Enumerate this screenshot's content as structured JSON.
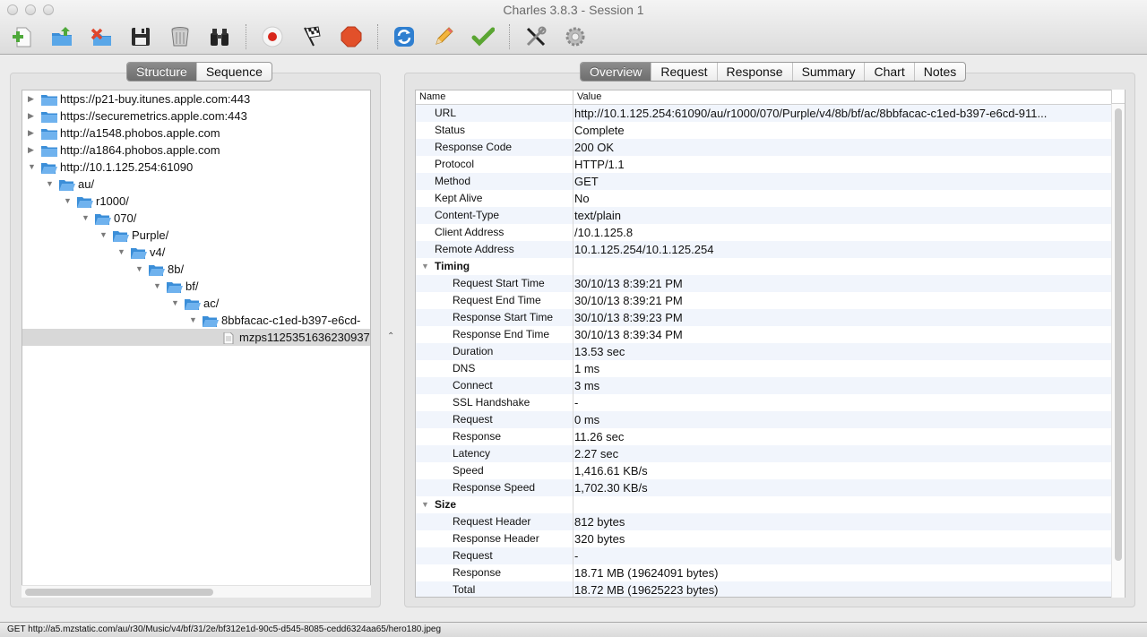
{
  "window": {
    "title": "Charles 3.8.3 - Session 1"
  },
  "toolbar": {
    "groups": [
      [
        {
          "name": "new-session",
          "icon": "new-session-icon"
        },
        {
          "name": "open-session",
          "icon": "open-folder-icon"
        },
        {
          "name": "close-session",
          "icon": "close-folder-icon"
        },
        {
          "name": "save-session",
          "icon": "save-icon"
        },
        {
          "name": "clear-session",
          "icon": "trash-icon"
        },
        {
          "name": "find",
          "icon": "binoculars-icon"
        }
      ],
      [
        {
          "name": "start-recording",
          "icon": "record-icon"
        },
        {
          "name": "start-throttling",
          "icon": "checkered-flag-icon"
        },
        {
          "name": "enable-breakpoints",
          "icon": "stop-sign-icon"
        }
      ],
      [
        {
          "name": "repeat",
          "icon": "refresh-icon"
        },
        {
          "name": "edit",
          "icon": "pencil-icon"
        },
        {
          "name": "validate",
          "icon": "checkmark-icon"
        }
      ],
      [
        {
          "name": "tools",
          "icon": "tools-icon"
        },
        {
          "name": "settings",
          "icon": "gear-icon"
        }
      ]
    ]
  },
  "left": {
    "tabs": [
      {
        "label": "Structure",
        "active": true
      },
      {
        "label": "Sequence",
        "active": false
      }
    ],
    "tree": [
      {
        "label": "https://p21-buy.itunes.apple.com:443",
        "depth": 0,
        "expanded": false,
        "type": "folder"
      },
      {
        "label": "https://securemetrics.apple.com:443",
        "depth": 0,
        "expanded": false,
        "type": "folder"
      },
      {
        "label": "http://a1548.phobos.apple.com",
        "depth": 0,
        "expanded": false,
        "type": "folder"
      },
      {
        "label": "http://a1864.phobos.apple.com",
        "depth": 0,
        "expanded": false,
        "type": "folder"
      },
      {
        "label": "http://10.1.125.254:61090",
        "depth": 0,
        "expanded": true,
        "type": "folder"
      },
      {
        "label": "au/",
        "depth": 1,
        "expanded": true,
        "type": "folder"
      },
      {
        "label": "r1000/",
        "depth": 2,
        "expanded": true,
        "type": "folder"
      },
      {
        "label": "070/",
        "depth": 3,
        "expanded": true,
        "type": "folder"
      },
      {
        "label": "Purple/",
        "depth": 4,
        "expanded": true,
        "type": "folder"
      },
      {
        "label": "v4/",
        "depth": 5,
        "expanded": true,
        "type": "folder"
      },
      {
        "label": "8b/",
        "depth": 6,
        "expanded": true,
        "type": "folder"
      },
      {
        "label": "bf/",
        "depth": 7,
        "expanded": true,
        "type": "folder"
      },
      {
        "label": "ac/",
        "depth": 8,
        "expanded": true,
        "type": "folder"
      },
      {
        "label": "8bbfacac-c1ed-b397-e6cd-",
        "depth": 9,
        "expanded": true,
        "type": "folder"
      },
      {
        "label": "mzps1125351636230937",
        "depth": 10,
        "expanded": false,
        "type": "file",
        "selected": true
      }
    ]
  },
  "right": {
    "tabs": [
      {
        "label": "Overview",
        "active": true
      },
      {
        "label": "Request",
        "active": false
      },
      {
        "label": "Response",
        "active": false
      },
      {
        "label": "Summary",
        "active": false
      },
      {
        "label": "Chart",
        "active": false
      },
      {
        "label": "Notes",
        "active": false
      }
    ],
    "columns": {
      "name": "Name",
      "value": "Value"
    },
    "rows": [
      {
        "name": "URL",
        "value": "http://10.1.125.254:61090/au/r1000/070/Purple/v4/8b/bf/ac/8bbfacac-c1ed-b397-e6cd-911...",
        "kind": "top"
      },
      {
        "name": "Status",
        "value": "Complete",
        "kind": "top"
      },
      {
        "name": "Response Code",
        "value": "200 OK",
        "kind": "top"
      },
      {
        "name": "Protocol",
        "value": "HTTP/1.1",
        "kind": "top"
      },
      {
        "name": "Method",
        "value": "GET",
        "kind": "top"
      },
      {
        "name": "Kept Alive",
        "value": "No",
        "kind": "top"
      },
      {
        "name": "Content-Type",
        "value": "text/plain",
        "kind": "top"
      },
      {
        "name": "Client Address",
        "value": "/10.1.125.8",
        "kind": "top"
      },
      {
        "name": "Remote Address",
        "value": "10.1.125.254/10.1.125.254",
        "kind": "top"
      },
      {
        "name": "Timing",
        "value": "",
        "kind": "section"
      },
      {
        "name": "Request Start Time",
        "value": "30/10/13 8:39:21 PM",
        "kind": "child"
      },
      {
        "name": "Request End Time",
        "value": "30/10/13 8:39:21 PM",
        "kind": "child"
      },
      {
        "name": "Response Start Time",
        "value": "30/10/13 8:39:23 PM",
        "kind": "child"
      },
      {
        "name": "Response End Time",
        "value": "30/10/13 8:39:34 PM",
        "kind": "child"
      },
      {
        "name": "Duration",
        "value": "13.53 sec",
        "kind": "child"
      },
      {
        "name": "DNS",
        "value": "1 ms",
        "kind": "child"
      },
      {
        "name": "Connect",
        "value": "3 ms",
        "kind": "child"
      },
      {
        "name": "SSL Handshake",
        "value": "-",
        "kind": "child"
      },
      {
        "name": "Request",
        "value": "0 ms",
        "kind": "child"
      },
      {
        "name": "Response",
        "value": "11.26 sec",
        "kind": "child"
      },
      {
        "name": "Latency",
        "value": "2.27 sec",
        "kind": "child"
      },
      {
        "name": "Speed",
        "value": "1,416.61 KB/s",
        "kind": "child"
      },
      {
        "name": "Response Speed",
        "value": "1,702.30 KB/s",
        "kind": "child"
      },
      {
        "name": "Size",
        "value": "",
        "kind": "section"
      },
      {
        "name": "Request Header",
        "value": "812 bytes",
        "kind": "child"
      },
      {
        "name": "Response Header",
        "value": "320 bytes",
        "kind": "child"
      },
      {
        "name": "Request",
        "value": "-",
        "kind": "child"
      },
      {
        "name": "Response",
        "value": "18.71 MB (19624091 bytes)",
        "kind": "child"
      },
      {
        "name": "Total",
        "value": "18.72 MB (19625223 bytes)",
        "kind": "child"
      }
    ]
  },
  "status_bar": {
    "text": "GET http://a5.mzstatic.com/au/r30/Music/v4/bf/31/2e/bf312e1d-90c5-d545-8085-cedd6324aa65/hero180.jpeg"
  },
  "colors": {
    "selected_row": "#d8d8d8",
    "alt_row": "#f1f5fc",
    "folder_blue": "#3b8ed8",
    "record_red": "#d8261b",
    "stop_orange": "#e2502a",
    "check_green": "#5aa532"
  }
}
